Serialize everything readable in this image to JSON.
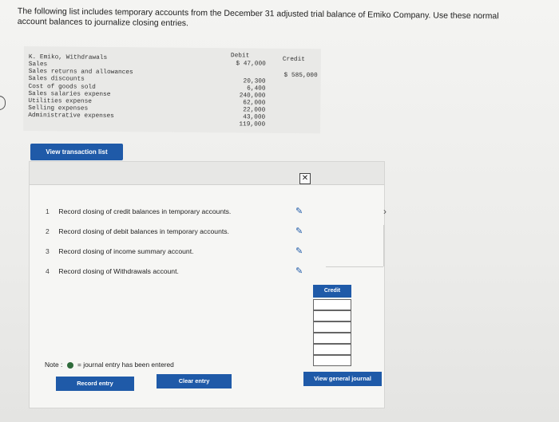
{
  "prompt": {
    "text": "The following list includes temporary accounts from the December 31 adjusted trial balance of Emiko Company. Use these normal account balances to journalize closing entries."
  },
  "trial_balance": {
    "headers": {
      "debit": "Debit",
      "credit": "Credit"
    },
    "rows": [
      {
        "account": "K. Emiko, Withdrawals",
        "debit": "$ 47,000",
        "credit": ""
      },
      {
        "account": "Sales",
        "debit": "",
        "credit": "$ 585,000"
      },
      {
        "account": "Sales returns and allowances",
        "debit": "20,300",
        "credit": ""
      },
      {
        "account": "Sales discounts",
        "debit": "6,400",
        "credit": ""
      },
      {
        "account": "Cost of goods sold",
        "debit": "240,000",
        "credit": ""
      },
      {
        "account": "Sales salaries expense",
        "debit": "62,000",
        "credit": ""
      },
      {
        "account": "Utilities expense",
        "debit": "22,000",
        "credit": ""
      },
      {
        "account": "Selling expenses",
        "debit": "43,000",
        "credit": ""
      },
      {
        "account": "Administrative expenses",
        "debit": "119,000",
        "credit": ""
      }
    ]
  },
  "view_transaction_list_label": "View transaction list",
  "tasks": [
    {
      "num": "1",
      "label": "Record closing of credit balances in temporary accounts."
    },
    {
      "num": "2",
      "label": "Record closing of debit balances in temporary accounts."
    },
    {
      "num": "3",
      "label": "Record closing of income summary account."
    },
    {
      "num": "4",
      "label": "Record closing of Withdrawals account."
    }
  ],
  "credit_column_label": "Credit",
  "note": {
    "prefix": "Note :",
    "text": "= journal entry has been entered"
  },
  "buttons": {
    "record_entry": "Record entry",
    "clear_entry": "Clear entry",
    "view_general_journal": "View general journal"
  },
  "colors": {
    "accent": "#1f5aa8",
    "entered_dot": "#2f6b3b"
  }
}
